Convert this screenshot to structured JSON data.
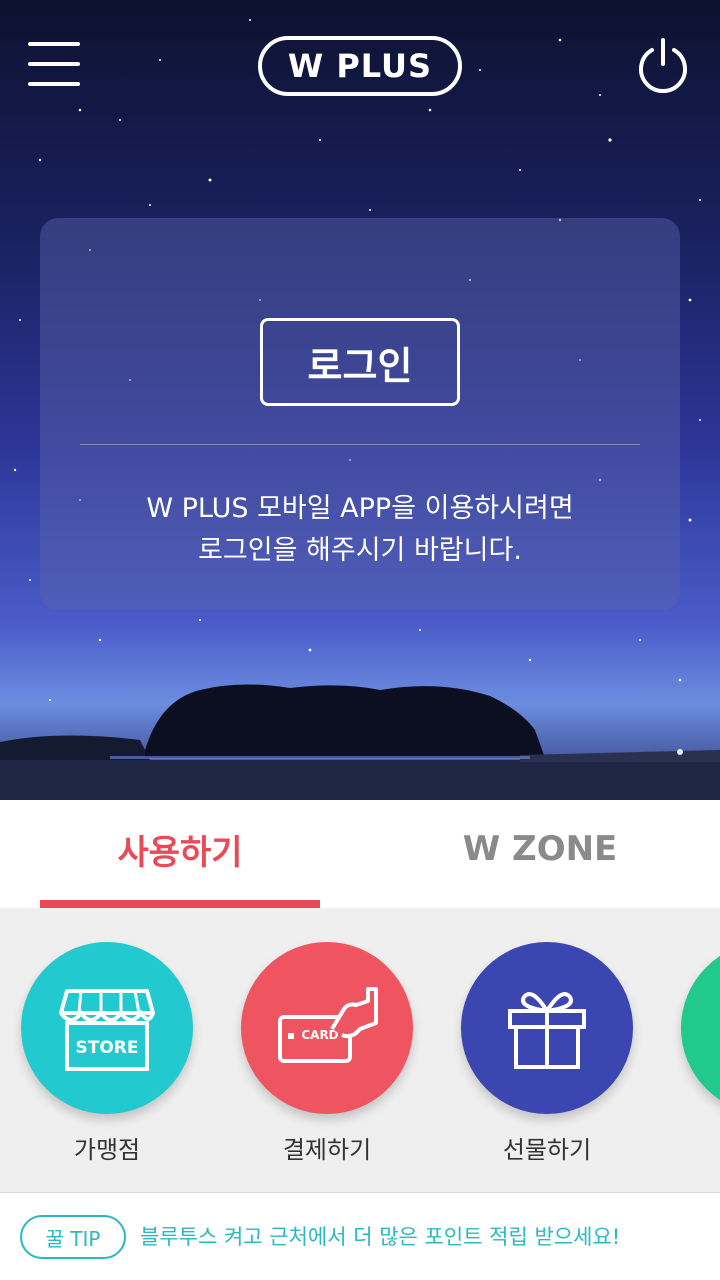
{
  "header": {
    "logo_text": "W PLUS",
    "menu_icon": "hamburger-menu-icon",
    "power_icon": "power-icon"
  },
  "login_card": {
    "button_label": "로그인",
    "message_line1": "W PLUS 모바일 APP을 이용하시려면",
    "message_line2": "로그인을 해주시기 바랍니다."
  },
  "tabs": [
    {
      "label": "사용하기",
      "active": true
    },
    {
      "label": "W ZONE",
      "active": false
    }
  ],
  "services": [
    {
      "label": "가맹점",
      "icon": "store-icon",
      "icon_text": "STORE",
      "color": "#22c9cf"
    },
    {
      "label": "결제하기",
      "icon": "card-payment-icon",
      "icon_text": "CARD",
      "color": "#ef5560"
    },
    {
      "label": "선물하기",
      "icon": "gift-icon",
      "color": "#3b46b0"
    },
    {
      "label": "",
      "icon": "partial-service-icon",
      "color": "#22c98c"
    }
  ],
  "tip": {
    "badge": "꿀 TIP",
    "text": "블루투스 켜고 근처에서 더 많은 포인트 적립 받으세요!"
  },
  "colors": {
    "accent_red": "#ea4a57",
    "tip_teal": "#2bb8c0",
    "inactive_tab": "#8a8a8a"
  }
}
